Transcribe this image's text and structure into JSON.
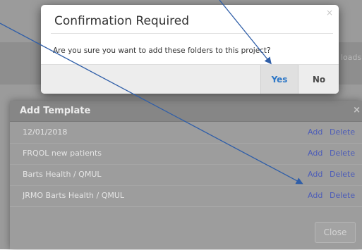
{
  "background": {
    "header_fragment": "loads"
  },
  "confirm_dialog": {
    "title": "Confirmation Required",
    "close_glyph": "×",
    "message": "Are you sure you want to add these folders to this project?",
    "yes_label": "Yes",
    "no_label": "No"
  },
  "template_dialog": {
    "title": "Add Template",
    "close_glyph": "×",
    "rows": [
      {
        "name": "12/01/2018",
        "add": "Add",
        "delete": "Delete"
      },
      {
        "name": "FRQOL new patients",
        "add": "Add",
        "delete": "Delete"
      },
      {
        "name": "Barts Health / QMUL",
        "add": "Add",
        "delete": "Delete"
      },
      {
        "name": "JRMO Barts Health / QMUL",
        "add": "Add",
        "delete": "Delete"
      }
    ],
    "close_label": "Close"
  },
  "colors": {
    "link": "#4c5cb8",
    "yes_text": "#2f78c7",
    "arrow": "#2f5ea8"
  }
}
